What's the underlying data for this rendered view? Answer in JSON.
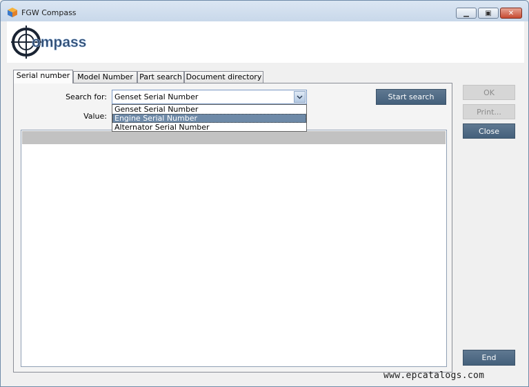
{
  "window": {
    "title": "FGW Compass",
    "controls": {
      "minimize": "▁",
      "maximize": "▣",
      "close": "✕"
    }
  },
  "logo": {
    "text": "ompass",
    "icon": "compass-crosshair-logo"
  },
  "tabs": [
    {
      "label": "Serial number",
      "active": true
    },
    {
      "label": "Model Number",
      "active": false
    },
    {
      "label": "Part search",
      "active": false
    },
    {
      "label": "Document directory",
      "active": false
    }
  ],
  "search": {
    "search_for_label": "Search for:",
    "value_label": "Value:",
    "selected": "Genset Serial Number",
    "options": [
      "Genset Serial Number",
      "Engine Serial Number",
      "Alternator Serial Number"
    ],
    "highlighted_option": "Engine Serial Number",
    "start_button": "Start search"
  },
  "side_buttons": {
    "ok": "OK",
    "print": "Print...",
    "close": "Close",
    "end": "End"
  },
  "watermark": "www.epcatalogs.com",
  "colors": {
    "button_dark": "#4f6a85",
    "selection": "#6e8aa8",
    "header_gray": "#c2c2c2"
  }
}
